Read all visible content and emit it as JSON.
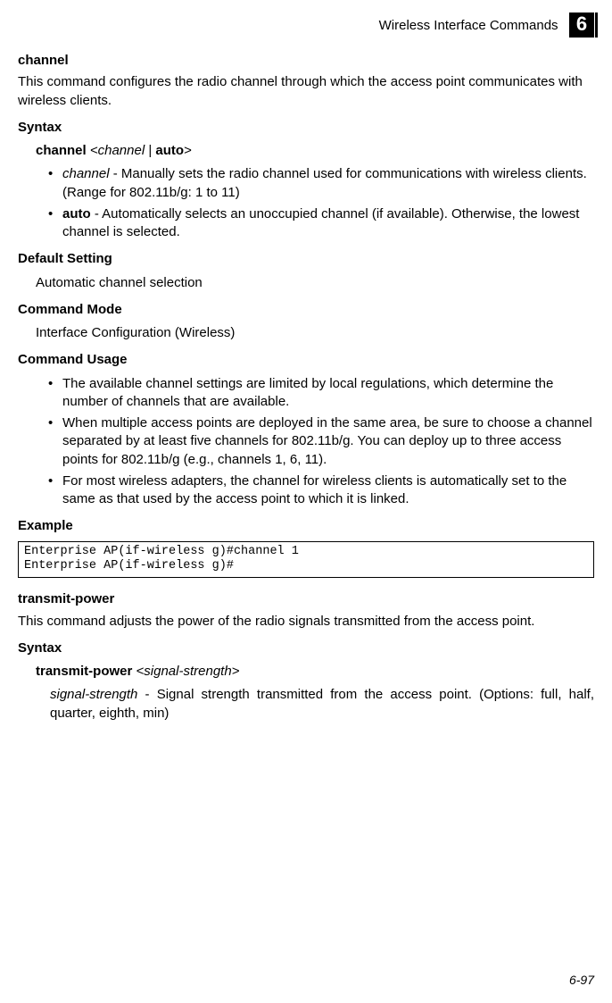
{
  "header": {
    "title": "Wireless Interface Commands",
    "chapter": "6"
  },
  "cmd1": {
    "name": "channel",
    "desc": "This command configures the radio channel through which the access point communicates with wireless clients.",
    "syntax_label": "Syntax",
    "syntax_kw": "channel",
    "syntax_arg": "<channel",
    "syntax_pipe": " | ",
    "syntax_auto": "auto",
    "syntax_close": ">",
    "param1_name": "channel",
    "param1_desc": " - Manually sets the radio channel used for communications with wireless clients. (Range for 802.11b/g: 1 to 11)",
    "param2_name": "auto",
    "param2_desc": " - Automatically selects an unoccupied channel (if available). Otherwise, the lowest channel is selected.",
    "default_label": "Default Setting",
    "default_value": "Automatic channel selection",
    "mode_label": "Command Mode",
    "mode_value": "Interface Configuration (Wireless)",
    "usage_label": "Command Usage",
    "usage1": "The available channel settings are limited by local regulations, which determine the number of channels that are available.",
    "usage2": "When multiple access points are deployed in the same area, be sure to choose a channel separated by at least five channels for 802.11b/g. You can deploy up to three access points for 802.11b/g (e.g., channels 1, 6, 11).",
    "usage3": "For most wireless adapters, the channel for wireless clients is automatically set to the same as that used by the access point to which it is linked.",
    "example_label": "Example",
    "example_code": "Enterprise AP(if-wireless g)#channel 1\nEnterprise AP(if-wireless g)#"
  },
  "cmd2": {
    "name": "transmit-power",
    "desc": "This command adjusts the power of the radio signals transmitted from the access point.",
    "syntax_label": "Syntax",
    "syntax_kw": "transmit-power",
    "syntax_arg": "<signal-strength>",
    "param1_name": "signal-strength",
    "param1_desc": " - Signal strength transmitted from the access point. (Options: full, half, quarter, eighth, min)"
  },
  "footer": {
    "page": "6-97"
  }
}
